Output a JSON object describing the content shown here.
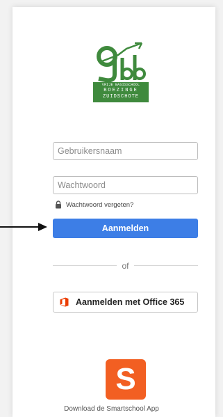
{
  "logo": {
    "mark": "gbb",
    "line1": "VRIJE BASISSCHOOL",
    "line2": "BOEZINGE",
    "line3": "ZUIDSCHOTE"
  },
  "form": {
    "username_placeholder": "Gebruikersnaam",
    "password_placeholder": "Wachtwoord",
    "forgot_label": "Wachtwoord vergeten?",
    "login_label": "Aanmelden"
  },
  "divider": {
    "label": "of"
  },
  "office": {
    "label": "Aanmelden met Office 365",
    "icon": "office-365-icon"
  },
  "app": {
    "icon_letter": "S",
    "caption": "Download de Smartschool App",
    "icon": "smartschool-app-icon"
  },
  "colors": {
    "primary": "#3d7ee6",
    "logo_green": "#3f8a3d",
    "office_orange": "#eb3c00",
    "smartschool_orange": "#f25f22"
  }
}
